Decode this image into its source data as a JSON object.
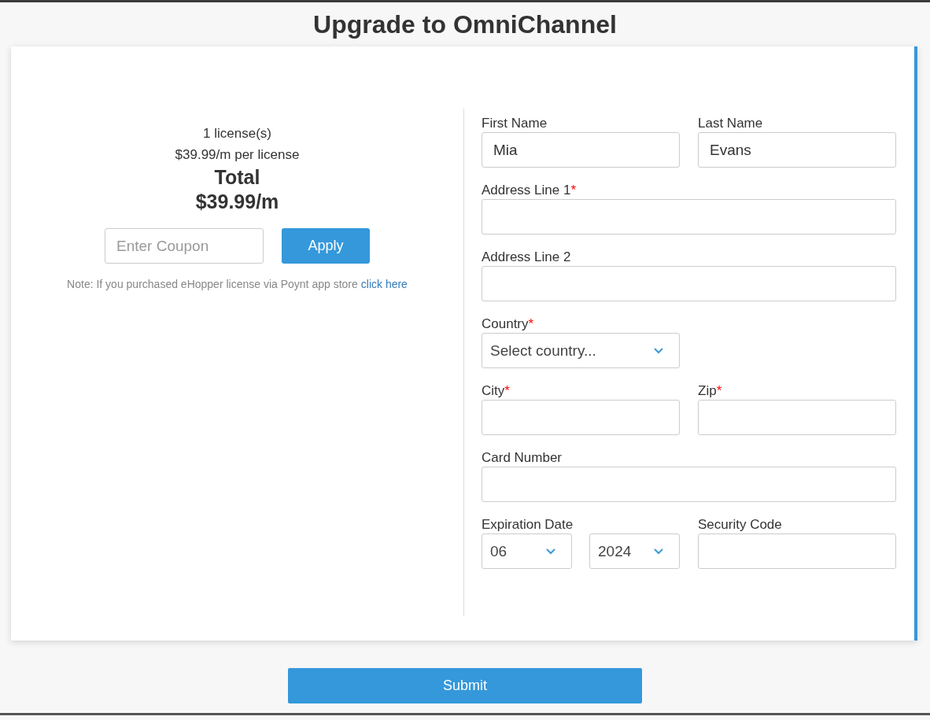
{
  "title": "Upgrade to OmniChannel",
  "summary": {
    "licenses": "1 license(s)",
    "price": "$39.99/m per license",
    "total_label": "Total",
    "total": "$39.99/m"
  },
  "coupon": {
    "placeholder": "Enter Coupon",
    "button": "Apply"
  },
  "note": {
    "text": "Note: If you purchased eHopper license via Poynt app store",
    "link": "click here"
  },
  "form": [
    [
      {
        "label": "First Name",
        "kind": "text",
        "value": "Mia"
      },
      {
        "label": "Last Name",
        "kind": "text",
        "value": "Evans"
      }
    ],
    [
      {
        "label": "Address Line 1",
        "required_mark": "*",
        "kind": "wide"
      }
    ],
    [
      {
        "label": "Address Line 2",
        "kind": "wide"
      }
    ],
    [
      {
        "label": "Country",
        "required_mark": "*",
        "kind": "select",
        "placeholder": "Select country..."
      }
    ],
    [
      {
        "label": "City",
        "required_mark": "*",
        "kind": "text"
      },
      {
        "label": "Zip",
        "required_mark": "*",
        "kind": "text"
      }
    ],
    [
      {
        "label": "Card Number",
        "kind": "wide"
      }
    ],
    [
      {
        "label": "Expiration Date",
        "kind": "select-pair",
        "values": [
          "06",
          "2024"
        ]
      },
      {
        "label": "Security Code",
        "kind": "text"
      }
    ]
  ],
  "submit": "Submit"
}
